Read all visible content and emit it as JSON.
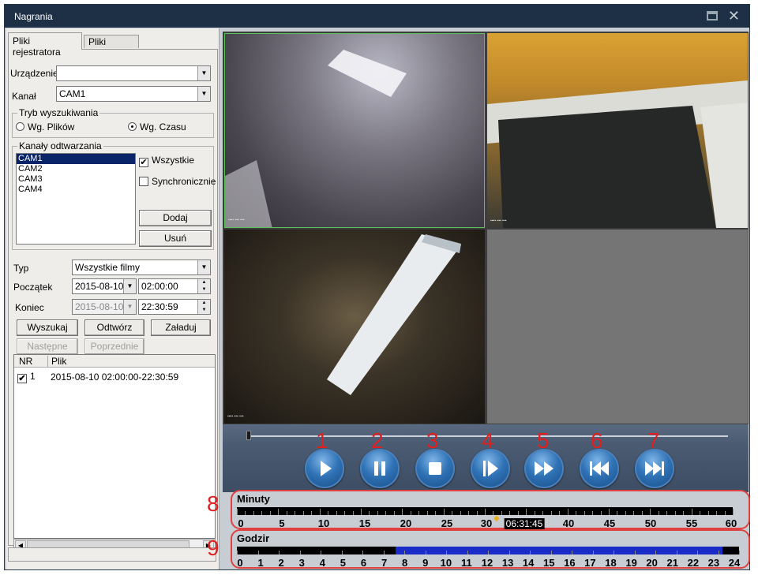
{
  "window": {
    "title": "Nagrania"
  },
  "tabs": [
    "Pliki rejestratora",
    "Pliki lokalne"
  ],
  "device": {
    "label": "Urządzenie",
    "value": ""
  },
  "channel": {
    "label": "Kanał",
    "value": "CAM1"
  },
  "search_mode": {
    "title": "Tryb wyszukiwania",
    "by_files": "Wg. Plików",
    "by_time": "Wg. Czasu",
    "selected": "by_time"
  },
  "playback_channels": {
    "title": "Kanały odtwarzania",
    "items": [
      "CAM1",
      "CAM2",
      "CAM3",
      "CAM4"
    ],
    "selected": "CAM1",
    "all_label": "Wszystkie",
    "all_checked": true,
    "sync_label": "Synchronicznie",
    "sync_checked": false,
    "add_label": "Dodaj",
    "remove_label": "Usuń"
  },
  "type": {
    "label": "Typ",
    "value": "Wszystkie filmy"
  },
  "start": {
    "label": "Początek",
    "date": "2015-08-10",
    "time": "02:00:00"
  },
  "end": {
    "label": "Koniec",
    "date": "2015-08-10",
    "time": "22:30:59"
  },
  "buttons": {
    "search": "Wyszukaj",
    "play": "Odtwórz",
    "load": "Załaduj",
    "next": "Następne",
    "prev": "Poprzednie"
  },
  "file_list": {
    "headers": [
      "NR",
      "Plik"
    ],
    "rows": [
      {
        "nr": "1",
        "file": "2015-08-10 02:00:00-22:30:59",
        "checked": true
      }
    ]
  },
  "playback_buttons": [
    {
      "num": "1",
      "icon": "play-icon"
    },
    {
      "num": "2",
      "icon": "pause-icon"
    },
    {
      "num": "3",
      "icon": "stop-icon"
    },
    {
      "num": "4",
      "icon": "step-frame-icon"
    },
    {
      "num": "5",
      "icon": "fast-forward-icon"
    },
    {
      "num": "6",
      "icon": "skip-back-icon"
    },
    {
      "num": "7",
      "icon": "skip-forward-icon"
    }
  ],
  "minutes_timeline": {
    "marker": "8",
    "title": "Minuty",
    "labels": [
      "0",
      "5",
      "10",
      "15",
      "20",
      "25",
      "30",
      "40",
      "45",
      "50",
      "55",
      "60"
    ],
    "current_time": "06:31:45"
  },
  "hours_timeline": {
    "marker": "9",
    "title": "Godzir",
    "labels": [
      "0",
      "1",
      "2",
      "3",
      "4",
      "5",
      "6",
      "7",
      "8",
      "9",
      "10",
      "11",
      "12",
      "13",
      "14",
      "15",
      "16",
      "17",
      "18",
      "19",
      "20",
      "21",
      "22",
      "23",
      "24"
    ],
    "recorded_from": 7.6,
    "recorded_to": 23.2,
    "recorded_color": "#1a2cc8"
  }
}
